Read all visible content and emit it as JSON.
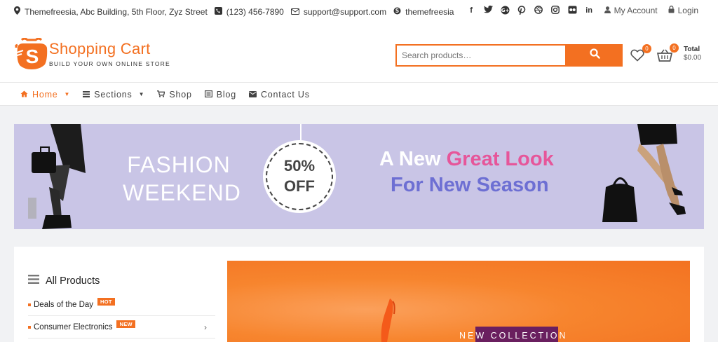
{
  "topbar": {
    "address": "Themefreesia, Abc Building, 5th Floor, Zyz Street",
    "phone": "(123) 456-7890",
    "email": "support@support.com",
    "skype": "themefreesia",
    "account_label": "My Account",
    "login_label": "Login",
    "social": [
      "facebook-icon",
      "twitter-icon",
      "google-plus-icon",
      "pinterest-icon",
      "dribbble-icon",
      "instagram-icon",
      "flickr-icon",
      "linkedin-icon"
    ]
  },
  "header": {
    "site_title": "Shopping Cart",
    "tagline": "BUILD YOUR OWN ONLINE STORE",
    "search_placeholder": "Search products…",
    "wishlist_count": "0",
    "cart_count": "0",
    "cart_total_label": "Total",
    "cart_total_value": "$0.00"
  },
  "nav": {
    "home": "Home",
    "sections": "Sections",
    "shop": "Shop",
    "blog": "Blog",
    "contact": "Contact Us"
  },
  "banner": {
    "title_line1": "FASHION",
    "title_line2": "WEEKEND",
    "discount_line1": "50%",
    "discount_line2": "OFF",
    "headline_prefix": "A New ",
    "headline_highlight": "Great Look",
    "subheadline": "For New Season"
  },
  "sidebar": {
    "title": "All Products",
    "items": [
      {
        "label": "Deals of the Day",
        "tag": "HOT"
      },
      {
        "label": "Consumer Electronics",
        "tag": "NEW"
      }
    ]
  },
  "promo": {
    "label": "NEW COLLECTION"
  },
  "colors": {
    "accent": "#f37021",
    "banner_bg": "#c9c5e6",
    "headline_pink": "#e6569a",
    "headline_purple": "#6d6fd3"
  }
}
